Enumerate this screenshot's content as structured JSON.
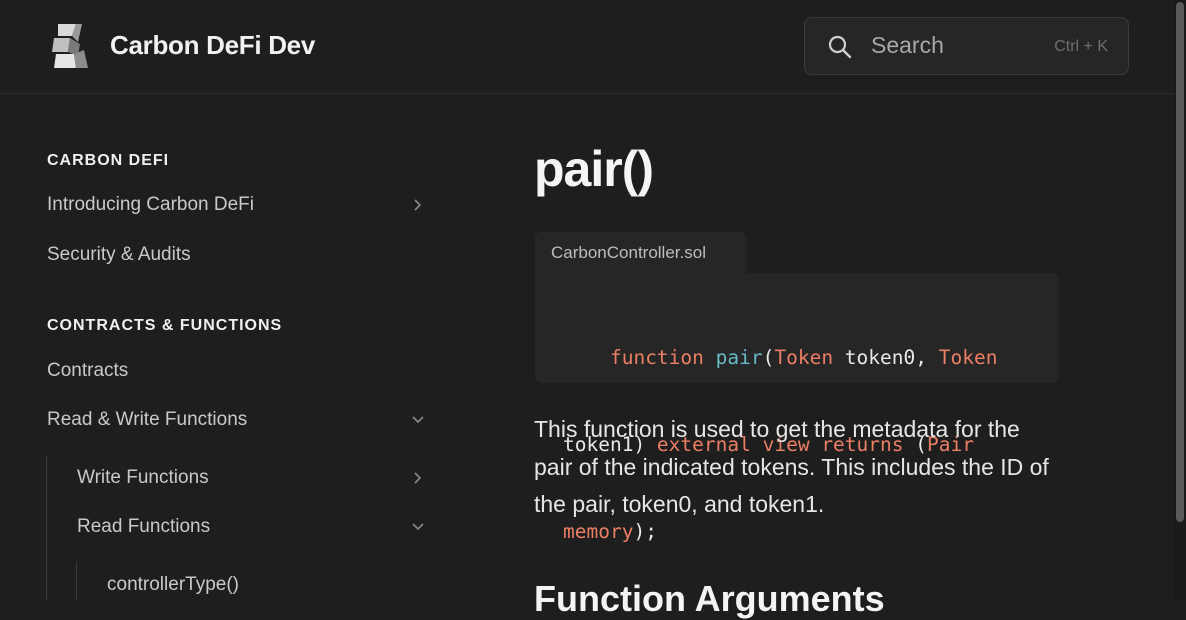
{
  "header": {
    "site_title": "Carbon DeFi Dev",
    "search_label": "Search",
    "search_shortcut": "Ctrl + K"
  },
  "sidebar": {
    "sections": [
      {
        "title": "CARBON DEFI",
        "items": [
          {
            "label": "Introducing Carbon DeFi",
            "chevron": "right"
          },
          {
            "label": "Security & Audits"
          }
        ]
      },
      {
        "title": "CONTRACTS & FUNCTIONS",
        "items": [
          {
            "label": "Contracts"
          },
          {
            "label": "Read & Write Functions",
            "chevron": "down"
          },
          {
            "label": "Write Functions",
            "chevron": "right"
          },
          {
            "label": "Read Functions",
            "chevron": "down"
          },
          {
            "label": "controllerType()"
          }
        ]
      }
    ]
  },
  "main": {
    "title": "pair()",
    "code": {
      "filename": "CarbonController.sol",
      "line1": {
        "t1": "function",
        "t2": "pair",
        "t3": "(",
        "t4": "Token",
        "t5": " token0, ",
        "t6": "Token"
      },
      "line2": {
        "t1": "token1) ",
        "t2": "external",
        "t3": "view",
        "t4": "returns",
        "t5": " (",
        "t6": "Pair"
      },
      "line3": {
        "t1": "memory",
        "t2": ");"
      }
    },
    "description": "This function is used to get the metadata for the pair of the indicated tokens. This includes the ID of the pair, token0, and token1.",
    "next_heading": "Function Arguments"
  },
  "colors": {
    "background": "#1e1e1e",
    "keyword": "#ec7f63",
    "function_name": "#67b9c8"
  }
}
